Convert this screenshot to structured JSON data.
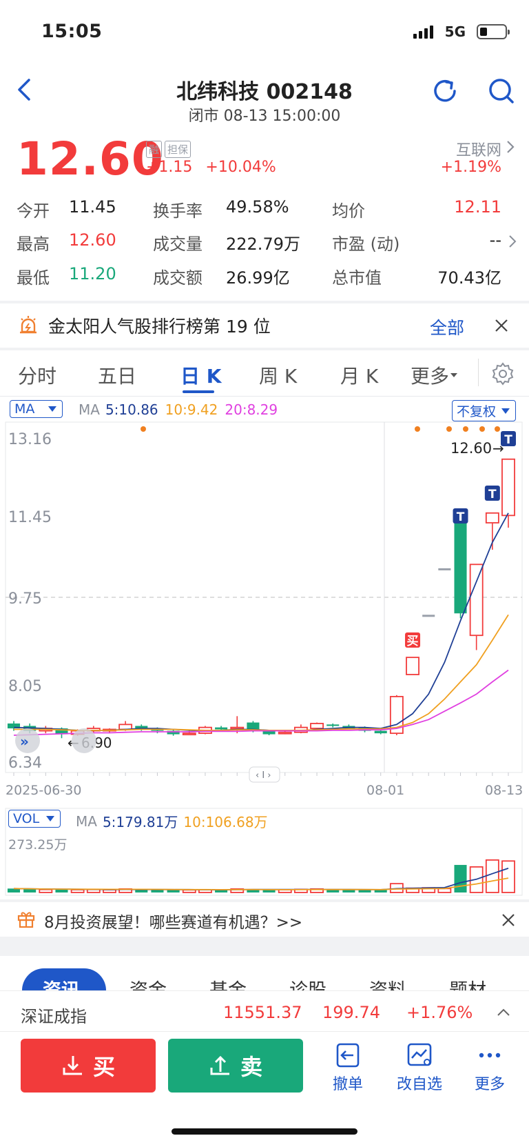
{
  "status": {
    "time": "15:05",
    "network": "5G"
  },
  "header": {
    "stock_name_code": "北纬科技 002148",
    "subtitle": "闭市 08-13 15:00:00"
  },
  "quote": {
    "price": "12.60",
    "tags": [
      "融",
      "担保"
    ],
    "change": "+1.15",
    "change_pct": "+10.04%",
    "sector_name": "互联网",
    "sector_change": "+1.19%"
  },
  "stats": {
    "open_label": "今开",
    "open": "11.45",
    "turnover_label": "换手率",
    "turnover": "49.58%",
    "avg_label": "均价",
    "avg": "12.11",
    "high_label": "最高",
    "high": "12.60",
    "volume_label": "成交量",
    "volume": "222.79万",
    "pe_label": "市盈 (动)",
    "pe": "--",
    "low_label": "最低",
    "low": "11.20",
    "amount_label": "成交额",
    "amount": "26.99亿",
    "mktcap_label": "总市值",
    "mktcap": "70.43亿"
  },
  "rank_banner": {
    "text": "金太阳人气股排行榜第 19 位",
    "action": "全部"
  },
  "tabs": [
    "分时",
    "五日",
    "日 K",
    "周 K",
    "月 K",
    "更多"
  ],
  "chart_toolbar": {
    "ma_select": "MA",
    "ma_label": "MA",
    "ma5": "5:10.86",
    "ma10": "10:9.42",
    "ma20": "20:8.29",
    "adjust": "不复权",
    "colors": {
      "ma5": "#1f3f95",
      "ma10": "#f0a020",
      "ma20": "#e040e0",
      "up": "#f23b3b",
      "down": "#19a87a"
    }
  },
  "chart_data": {
    "type": "candlestick",
    "y_ticks": [
      "13.16",
      "11.45",
      "9.75",
      "8.05",
      "6.34"
    ],
    "x_ticks": [
      "2025-06-30",
      "08-01",
      "08-13"
    ],
    "ylim": [
      6.34,
      13.16
    ],
    "annotations": {
      "last_price": "12.60",
      "min_price": "6.90",
      "buy_marker": "买",
      "t_marker": "T"
    },
    "candles": [
      {
        "o": 7.2,
        "c": 7.1,
        "h": 7.25,
        "l": 7.05
      },
      {
        "o": 7.15,
        "c": 7.05,
        "h": 7.2,
        "l": 7.0
      },
      {
        "o": 7.05,
        "c": 7.1,
        "h": 7.15,
        "l": 7.0
      },
      {
        "o": 7.1,
        "c": 6.98,
        "h": 7.12,
        "l": 6.9
      },
      {
        "o": 6.98,
        "c": 7.05,
        "h": 7.08,
        "l": 6.95
      },
      {
        "o": 7.05,
        "c": 7.1,
        "h": 7.15,
        "l": 7.0
      },
      {
        "o": 7.05,
        "c": 7.08,
        "h": 7.1,
        "l": 7.0
      },
      {
        "o": 7.08,
        "c": 7.18,
        "h": 7.25,
        "l": 7.05
      },
      {
        "o": 7.15,
        "c": 7.1,
        "h": 7.18,
        "l": 7.05
      },
      {
        "o": 7.1,
        "c": 7.05,
        "h": 7.12,
        "l": 7.0
      },
      {
        "o": 7.05,
        "c": 6.98,
        "h": 7.08,
        "l": 6.95
      },
      {
        "o": 6.98,
        "c": 7.0,
        "h": 7.05,
        "l": 6.96
      },
      {
        "o": 7.0,
        "c": 7.12,
        "h": 7.15,
        "l": 6.98
      },
      {
        "o": 7.12,
        "c": 7.08,
        "h": 7.15,
        "l": 7.05
      },
      {
        "o": 7.1,
        "c": 7.12,
        "h": 7.35,
        "l": 7.0
      },
      {
        "o": 7.22,
        "c": 7.05,
        "h": 7.25,
        "l": 7.02
      },
      {
        "o": 7.05,
        "c": 6.98,
        "h": 7.07,
        "l": 6.96
      },
      {
        "o": 7.0,
        "c": 7.02,
        "h": 7.06,
        "l": 6.98
      },
      {
        "o": 7.02,
        "c": 7.12,
        "h": 7.18,
        "l": 7.0
      },
      {
        "o": 7.1,
        "c": 7.2,
        "h": 7.22,
        "l": 7.08
      },
      {
        "o": 7.18,
        "c": 7.15,
        "h": 7.2,
        "l": 7.12
      },
      {
        "o": 7.15,
        "c": 7.1,
        "h": 7.18,
        "l": 7.08
      },
      {
        "o": 7.12,
        "c": 7.05,
        "h": 7.14,
        "l": 7.02
      },
      {
        "o": 7.05,
        "c": 7.0,
        "h": 7.08,
        "l": 6.98
      },
      {
        "o": 7.0,
        "c": 7.75,
        "h": 7.78,
        "l": 6.96
      },
      {
        "o": 8.2,
        "c": 8.55,
        "h": 8.55,
        "l": 8.2
      },
      {
        "o": 9.4,
        "c": 9.4,
        "h": 9.4,
        "l": 9.4
      },
      {
        "o": 10.35,
        "c": 10.35,
        "h": 10.35,
        "l": 10.35
      },
      {
        "o": 11.45,
        "c": 9.45,
        "h": 11.45,
        "l": 9.35
      },
      {
        "o": 9.0,
        "c": 10.45,
        "h": 10.45,
        "l": 8.7
      },
      {
        "o": 11.3,
        "c": 11.5,
        "h": 11.5,
        "l": 10.75
      },
      {
        "o": 11.45,
        "c": 12.6,
        "h": 12.6,
        "l": 11.2
      }
    ],
    "ma5": [
      7.12,
      7.11,
      7.1,
      7.08,
      7.06,
      7.06,
      7.06,
      7.08,
      7.1,
      7.1,
      7.08,
      7.06,
      7.05,
      7.06,
      7.08,
      7.08,
      7.06,
      7.05,
      7.05,
      7.08,
      7.1,
      7.12,
      7.12,
      7.1,
      7.18,
      7.4,
      7.8,
      8.45,
      9.3,
      10.1,
      10.9,
      11.5
    ],
    "ma10": [
      7.08,
      7.08,
      7.08,
      7.07,
      7.06,
      7.06,
      7.06,
      7.07,
      7.08,
      7.08,
      7.08,
      7.07,
      7.06,
      7.06,
      7.07,
      7.07,
      7.06,
      7.06,
      7.06,
      7.07,
      7.08,
      7.09,
      7.09,
      7.09,
      7.12,
      7.22,
      7.4,
      7.7,
      8.05,
      8.4,
      8.9,
      9.42
    ],
    "ma20": [
      6.96,
      6.97,
      6.98,
      6.99,
      7.0,
      7.01,
      7.01,
      7.02,
      7.03,
      7.03,
      7.03,
      7.03,
      7.04,
      7.04,
      7.04,
      7.05,
      7.05,
      7.05,
      7.05,
      7.05,
      7.06,
      7.06,
      7.07,
      7.07,
      7.1,
      7.18,
      7.28,
      7.45,
      7.62,
      7.8,
      8.05,
      8.29
    ],
    "volume": {
      "label": "VOL",
      "ma_label": "MA",
      "ma5": "5:179.81万",
      "ma10": "10:106.68万",
      "max_label": "273.25万",
      "bars": [
        20,
        18,
        15,
        16,
        14,
        15,
        14,
        18,
        15,
        14,
        13,
        13,
        14,
        14,
        18,
        16,
        13,
        14,
        16,
        18,
        14,
        13,
        13,
        13,
        45,
        22,
        24,
        20,
        140,
        130,
        165,
        160
      ]
    }
  },
  "promo": {
    "text": "8月投资展望！哪些赛道有机遇？>>"
  },
  "bottom_tabs": [
    "资讯",
    "资金",
    "基金",
    "诊股",
    "资料",
    "题材"
  ],
  "index_bar": {
    "name": "深证成指",
    "value": "11551.37",
    "change": "199.74",
    "change_pct": "+1.76%"
  },
  "actions": {
    "buy": "买",
    "sell": "卖",
    "cancel": "撤单",
    "edit_watch": "改自选",
    "more": "更多"
  }
}
